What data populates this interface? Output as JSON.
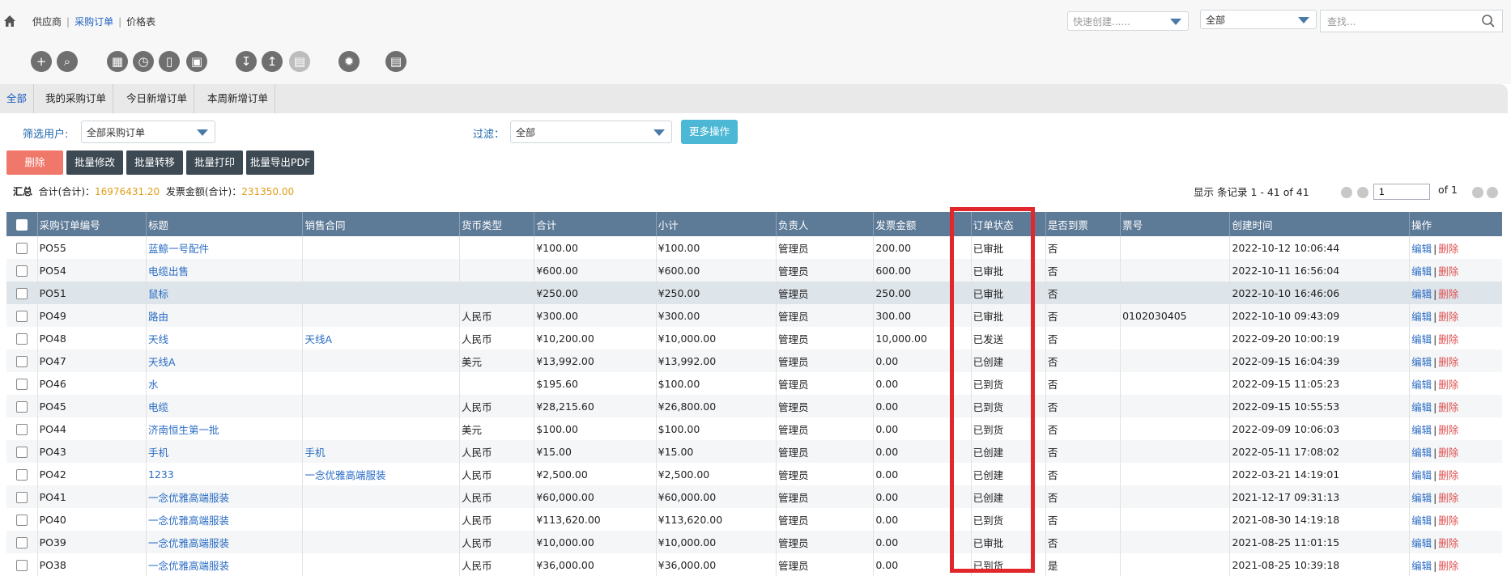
{
  "breadcrumb": {
    "items": [
      "供应商",
      "采购订单",
      "价格表"
    ],
    "active_index": 1
  },
  "header": {
    "quick_create_placeholder": "快速创建......",
    "scope_value": "全部",
    "search_placeholder": "查找..."
  },
  "toolbar_icons": [
    "add-icon",
    "search-zoom-icon",
    "calendar-icon",
    "clock-icon",
    "mobile-icon",
    "monitor-icon",
    "import-icon",
    "export-icon",
    "print-icon",
    "settings-icon",
    "screen-icon"
  ],
  "tabs": [
    "全部",
    "我的采购订单",
    "今日新增订单",
    "本周新增订单"
  ],
  "filters": {
    "user_label": "筛选用户:",
    "user_value": "全部采购订单",
    "filter_label": "过滤：",
    "filter_value": "全部",
    "more_label": "更多操作"
  },
  "actions": {
    "delete": "删除",
    "batch_edit": "批量修改",
    "batch_transfer": "批量转移",
    "batch_print": "批量打印",
    "batch_export_pdf": "批量导出PDF"
  },
  "summary": {
    "title": "汇总",
    "total_label": "合计(合计)：",
    "total_value": "16976431.20",
    "invoice_label": "发票金额(合计)：",
    "invoice_value": "231350.00"
  },
  "pager": {
    "info": "显示 条记录 1 - 41 of 41",
    "page_value": "1",
    "of_text": "of 1"
  },
  "table": {
    "columns": [
      "采购订单编号",
      "标题",
      "销售合同",
      "货币类型",
      "合计",
      "小计",
      "负责人",
      "发票金额",
      "订单状态",
      "是否到票",
      "票号",
      "创建时间",
      "操作"
    ],
    "edit_label": "编辑",
    "delete_label": "删除",
    "rows": [
      [
        "PO55",
        "蓝鲸一号配件",
        "",
        "",
        "¥100.00",
        "¥100.00",
        "管理员",
        "200.00",
        "已审批",
        "否",
        "",
        "2022-10-12 10:06:44"
      ],
      [
        "PO54",
        "电缆出售",
        "",
        "",
        "¥600.00",
        "¥600.00",
        "管理员",
        "600.00",
        "已审批",
        "否",
        "",
        "2022-10-11 16:56:04"
      ],
      [
        "PO51",
        "鼠标",
        "",
        "",
        "¥250.00",
        "¥250.00",
        "管理员",
        "250.00",
        "已审批",
        "否",
        "",
        "2022-10-10 16:46:06"
      ],
      [
        "PO49",
        "路由",
        "",
        "人民币",
        "¥300.00",
        "¥300.00",
        "管理员",
        "300.00",
        "已审批",
        "否",
        "0102030405",
        "2022-10-10 09:43:09"
      ],
      [
        "PO48",
        "天线",
        "天线A",
        "人民币",
        "¥10,200.00",
        "¥10,000.00",
        "管理员",
        "10,000.00",
        "已发送",
        "否",
        "",
        "2022-09-20 10:00:19"
      ],
      [
        "PO47",
        "天线A",
        "",
        "美元",
        "¥13,992.00",
        "¥13,992.00",
        "管理员",
        "0.00",
        "已创建",
        "否",
        "",
        "2022-09-15 16:04:39"
      ],
      [
        "PO46",
        "水",
        "",
        "",
        "$195.60",
        "$100.00",
        "管理员",
        "0.00",
        "已到货",
        "否",
        "",
        "2022-09-15 11:05:23"
      ],
      [
        "PO45",
        "电缆",
        "",
        "人民币",
        "¥28,215.60",
        "¥26,800.00",
        "管理员",
        "0.00",
        "已到货",
        "否",
        "",
        "2022-09-15 10:55:53"
      ],
      [
        "PO44",
        "济南恒生第一批",
        "",
        "美元",
        "$100.00",
        "$100.00",
        "管理员",
        "0.00",
        "已到货",
        "否",
        "",
        "2022-09-09 10:06:03"
      ],
      [
        "PO43",
        "手机",
        "手机",
        "人民币",
        "¥15.00",
        "¥15.00",
        "管理员",
        "0.00",
        "已创建",
        "否",
        "",
        "2022-05-11 17:08:02"
      ],
      [
        "PO42",
        "1233",
        "一念优雅高端服装",
        "人民币",
        "¥2,500.00",
        "¥2,500.00",
        "管理员",
        "0.00",
        "已创建",
        "否",
        "",
        "2022-03-21 14:19:01"
      ],
      [
        "PO41",
        "一念优雅高端服装",
        "",
        "人民币",
        "¥60,000.00",
        "¥60,000.00",
        "管理员",
        "0.00",
        "已创建",
        "否",
        "",
        "2021-12-17 09:31:13"
      ],
      [
        "PO40",
        "一念优雅高端服装",
        "",
        "人民币",
        "¥113,620.00",
        "¥113,620.00",
        "管理员",
        "0.00",
        "已到货",
        "否",
        "",
        "2021-08-30 14:19:18"
      ],
      [
        "PO39",
        "一念优雅高端服装",
        "",
        "人民币",
        "¥10,000.00",
        "¥10,000.00",
        "管理员",
        "0.00",
        "已审批",
        "否",
        "",
        "2021-08-25 11:01:15"
      ],
      [
        "PO38",
        "一念优雅高端服装",
        "",
        "人民币",
        "¥36,000.00",
        "¥36,000.00",
        "管理员",
        "0.00",
        "已到货",
        "是",
        "",
        "2021-08-25 10:39:18"
      ]
    ]
  }
}
